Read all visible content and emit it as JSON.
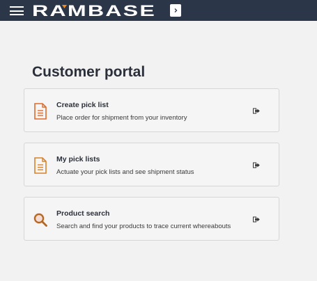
{
  "header": {
    "logo_text": "RAMBASE",
    "menu_icon": "hamburger-menu-icon",
    "expand_icon": "chevron-right-icon",
    "brand_color": "#2b3648",
    "accent_color": "#f08a24"
  },
  "page": {
    "title": "Customer portal"
  },
  "cards": [
    {
      "title": "Create pick list",
      "description": "Place order for shipment from your inventory",
      "icon": "document-list-icon",
      "icon_color": "#e06a2a",
      "action_icon": "exit-arrow-icon"
    },
    {
      "title": "My pick lists",
      "description": "Actuate your pick lists and see shipment status",
      "icon": "document-list-icon",
      "icon_color": "#d9822b",
      "action_icon": "exit-arrow-icon"
    },
    {
      "title": "Product search",
      "description": "Search and find your products to trace current whereabouts",
      "icon": "magnifier-icon",
      "icon_color": "#b5651d",
      "action_icon": "exit-arrow-icon"
    }
  ]
}
